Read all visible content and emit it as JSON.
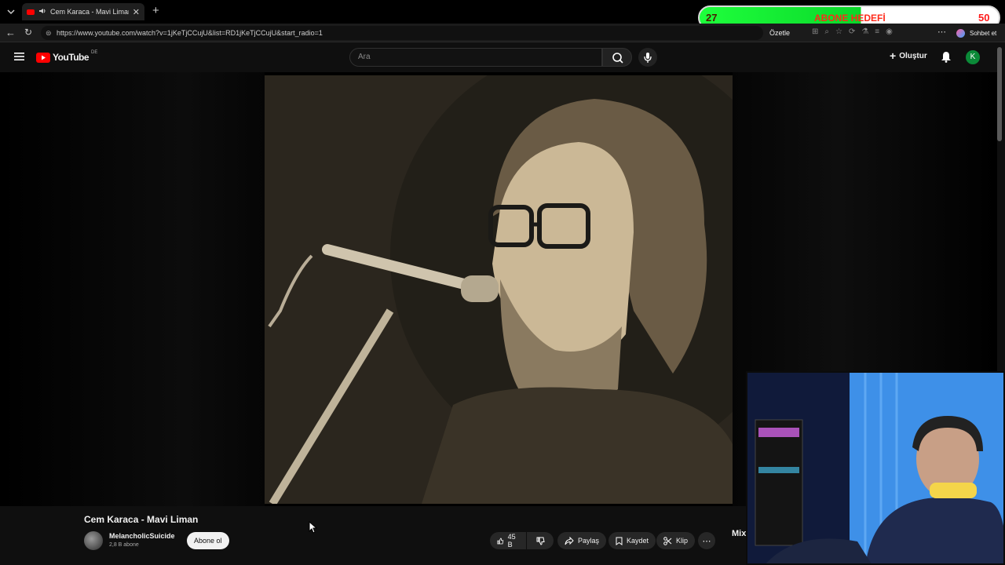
{
  "browser": {
    "tab_title": "Cem Karaca - Mavi Liman - Yo",
    "url": "https://www.youtube.com/watch?v=1jKeTjCCujU&list=RD1jKeTjCCujU&start_radio=1",
    "ozetle_label": "Özetle",
    "sohbet_label": "Sohbet et"
  },
  "youtube": {
    "logo_text": "YouTube",
    "region": "DE",
    "search_placeholder": "Ara",
    "create_label": "Oluştur",
    "avatar_letter": "K"
  },
  "video": {
    "title": "Cem Karaca - Mavi Liman",
    "channel": "MelancholicSuicide",
    "subscribers": "2,8 B abone",
    "subscribe_label": "Abone ol",
    "likes": "45 B",
    "share_label": "Paylaş",
    "save_label": "Kaydet",
    "clip_label": "Klip",
    "mix_label": "Mix"
  },
  "overlay": {
    "goal_current": "27",
    "goal_label": "ABONE HEDEFİ",
    "goal_target": "50",
    "goal_fraction": 0.54
  }
}
